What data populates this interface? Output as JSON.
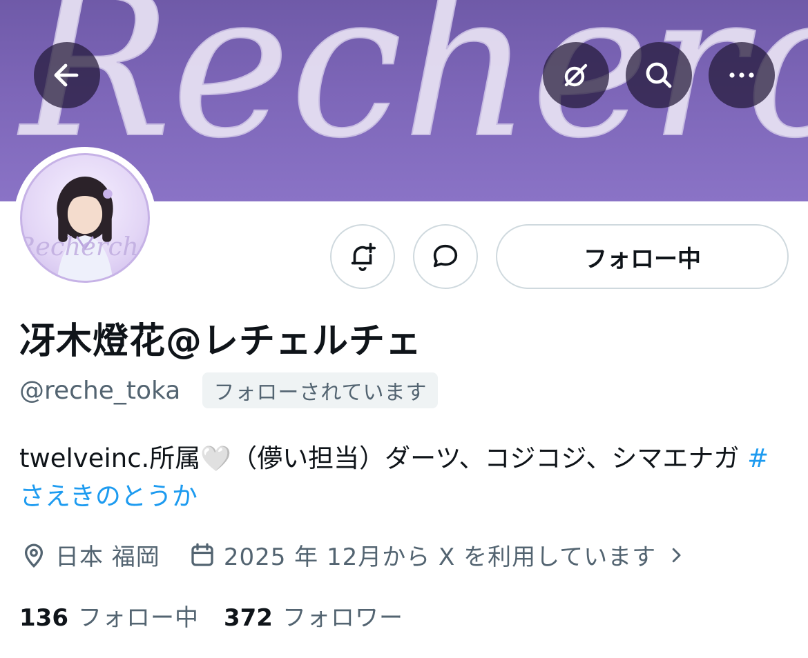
{
  "banner": {
    "script_text": "Recherche",
    "background_color": "#7d66b8"
  },
  "avatar": {
    "image_text": "Recherche"
  },
  "header_buttons": {
    "back_icon": "arrow-left-icon",
    "grok_icon": "grok-icon",
    "search_icon": "search-icon",
    "more_icon": "more-horizontal-icon"
  },
  "actions": {
    "notify_icon": "bell-plus-icon",
    "message_icon": "message-bubble-icon",
    "follow_label": "フォロー中"
  },
  "profile": {
    "display_name": "冴木燈花@レチェルチェ",
    "handle": "@reche_toka",
    "follows_you": "フォローされています",
    "bio_text": "twelveinc.所属",
    "bio_heart": "🤍",
    "bio_rest": "（儚い担当）ダーツ、コジコジ、シマエナガ ",
    "bio_hashtag": "#さえきのとうか",
    "location": "日本 福岡",
    "joined": "2025 年 12月から X を利用しています"
  },
  "stats": {
    "following_count": "136",
    "following_label": "フォロー中",
    "followers_count": "372",
    "followers_label": "フォロワー"
  },
  "colors": {
    "link": "#1d9bf0",
    "secondary_text": "#536471",
    "border": "#cfd9de"
  }
}
